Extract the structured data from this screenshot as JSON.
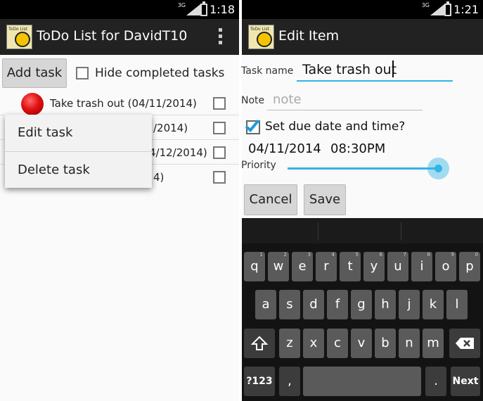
{
  "left": {
    "status": {
      "network": "3G",
      "time": "1:18"
    },
    "action_bar": {
      "logo_text": "ToDo List",
      "title": "ToDo List for DavidT10"
    },
    "add_task_label": "Add task",
    "hide_completed_label": "Hide completed tasks",
    "tasks": [
      {
        "text": "Take trash out (04/11/2014)",
        "priority_color": "#e01010"
      },
      {
        "text": "/2014)"
      },
      {
        "text": "4/12/2014)"
      },
      {
        "text": "4)"
      }
    ],
    "context_menu": {
      "items": [
        "Edit task",
        "Delete task"
      ]
    }
  },
  "right": {
    "status": {
      "network": "3G",
      "time": "1:21"
    },
    "action_bar": {
      "logo_text": "ToDo List",
      "title": "Edit Item"
    },
    "task_name_label": "Task name",
    "task_name_value": "Take trash out",
    "note_label": "Note",
    "note_placeholder": "note",
    "due_checkbox_label": "Set due date and time?",
    "due_checked": true,
    "due_date": "04/11/2014",
    "due_time": "08:30PM",
    "priority_label": "Priority",
    "priority_level": 1.0,
    "cancel_label": "Cancel",
    "save_label": "Save"
  },
  "keyboard": {
    "row1": [
      {
        "key": "q",
        "hint": "1"
      },
      {
        "key": "w",
        "hint": "2"
      },
      {
        "key": "e",
        "hint": "3"
      },
      {
        "key": "r",
        "hint": "4"
      },
      {
        "key": "t",
        "hint": "5"
      },
      {
        "key": "y",
        "hint": "6"
      },
      {
        "key": "u",
        "hint": "7"
      },
      {
        "key": "i",
        "hint": "8"
      },
      {
        "key": "o",
        "hint": "9"
      },
      {
        "key": "p",
        "hint": "0"
      }
    ],
    "row2": [
      "a",
      "s",
      "d",
      "f",
      "g",
      "h",
      "j",
      "k",
      "l"
    ],
    "row3": [
      "z",
      "x",
      "c",
      "v",
      "b",
      "n",
      "m"
    ],
    "symbols_label": "?123",
    "comma": ",",
    "period": ".",
    "next_label": "Next",
    "accent_color": "#33b5e5"
  }
}
